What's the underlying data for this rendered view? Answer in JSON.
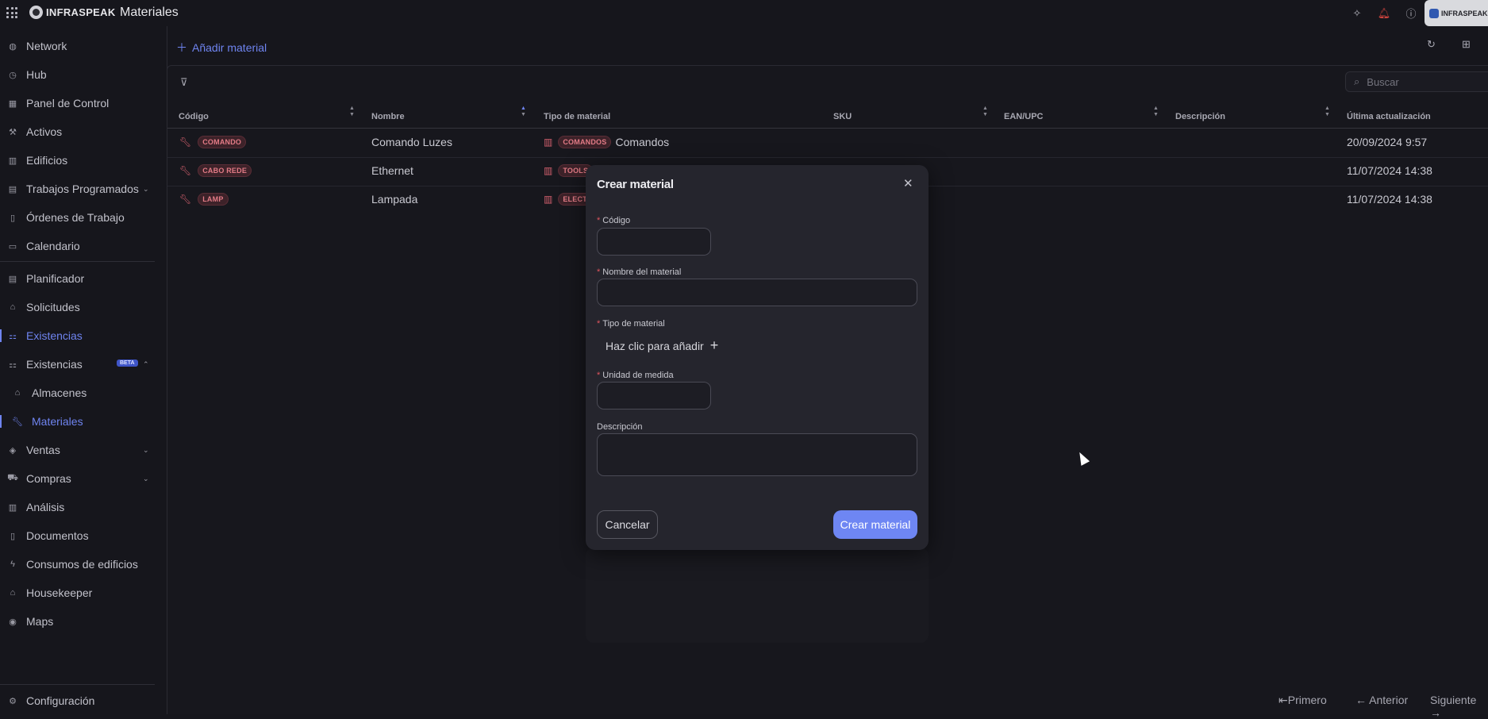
{
  "app": {
    "brand": "INFRASPEAK",
    "page_title": "Materiales"
  },
  "topbar_icons": [
    "sparkle-icon",
    "bell-alert-icon",
    "help-icon"
  ],
  "account": {
    "label": "INFRASPEAK"
  },
  "sidebar": {
    "items": [
      {
        "label": "Network",
        "icon": "globe-icon"
      },
      {
        "label": "Hub",
        "icon": "clock-icon"
      },
      {
        "label": "Panel de Control",
        "icon": "dashboard-icon"
      },
      {
        "label": "Activos",
        "icon": "tools-icon"
      },
      {
        "label": "Edificios",
        "icon": "building-icon"
      },
      {
        "label": "Trabajos Programados",
        "icon": "calendar-repeat-icon"
      },
      {
        "label": "Órdenes de Trabajo",
        "icon": "clipboard-icon"
      },
      {
        "label": "Calendario",
        "icon": "calendar-icon"
      },
      {
        "label": "Planificador",
        "icon": "planner-icon"
      },
      {
        "label": "Solicitudes",
        "icon": "bell-icon"
      },
      {
        "label": "Existencias",
        "icon": "stock-icon"
      },
      {
        "label": "Existencias",
        "icon": "stock-icon",
        "badge": "BETA"
      },
      {
        "label": "Almacenes",
        "icon": "warehouse-icon"
      },
      {
        "label": "Materiales",
        "icon": "wrench-icon"
      },
      {
        "label": "Ventas",
        "icon": "tag-icon"
      },
      {
        "label": "Compras",
        "icon": "cart-icon"
      },
      {
        "label": "Análisis",
        "icon": "chart-icon"
      },
      {
        "label": "Documentos",
        "icon": "document-icon"
      },
      {
        "label": "Consumos de edificios",
        "icon": "bolt-icon"
      },
      {
        "label": "Housekeeper",
        "icon": "house-icon"
      },
      {
        "label": "Maps",
        "icon": "pin-icon"
      },
      {
        "label": "Configuración",
        "icon": "gear-icon"
      }
    ]
  },
  "toolbar": {
    "add_label": "Añadir material",
    "search_placeholder": "Buscar"
  },
  "table": {
    "columns": [
      "Código",
      "Nombre",
      "Tipo de material",
      "SKU",
      "EAN/UPC",
      "Descripción",
      "Última actualización"
    ],
    "rows": [
      {
        "code": "COMANDO",
        "name": "Comando Luzes",
        "type_tag": "COMANDOS",
        "type_name": "Comandos",
        "updated": "20/09/2024 9:57"
      },
      {
        "code": "CABO REDE",
        "name": "Ethernet",
        "type_tag": "TOOLS",
        "type_name": "",
        "updated": "11/07/2024 14:38"
      },
      {
        "code": "LAMP",
        "name": "Lampada",
        "type_tag": "ELECTI",
        "type_name": "",
        "updated": "11/07/2024 14:38"
      }
    ]
  },
  "pagination": {
    "first": "Primero",
    "prev": "Anterior",
    "next": "Siguiente"
  },
  "modal": {
    "title": "Crear material",
    "fields": {
      "code_label": "Código",
      "name_label": "Nombre del material",
      "type_label": "Tipo de material",
      "type_add": "Haz clic para añadir",
      "unit_label": "Unidad de medida",
      "desc_label": "Descripción"
    },
    "cancel": "Cancelar",
    "submit": "Crear material"
  },
  "colors": {
    "accent": "#6e86f3",
    "background": "#16161c",
    "danger": "#d4606e"
  }
}
